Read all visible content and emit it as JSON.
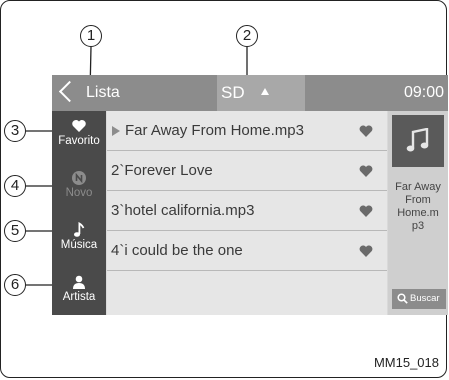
{
  "header": {
    "back_label": "Lista",
    "source_label": "SD",
    "clock": "09:00"
  },
  "sidebar": {
    "items": [
      {
        "label": "Favorito",
        "icon": "heart-icon"
      },
      {
        "label": "Novo",
        "icon": "new-badge-icon"
      },
      {
        "label": "Música",
        "icon": "music-note-icon"
      },
      {
        "label": "Artista",
        "icon": "person-icon"
      }
    ]
  },
  "tracks": [
    {
      "title": "Far Away From Home.mp3"
    },
    {
      "title": "2`Forever Love"
    },
    {
      "title": "3`hotel california.mp3"
    },
    {
      "title": "4`i could be the one"
    }
  ],
  "now_playing": {
    "name_lines": [
      "Far Away",
      "From",
      "Home.m",
      "p3"
    ],
    "search_label": "Buscar"
  },
  "callouts": [
    "1",
    "2",
    "3",
    "4",
    "5",
    "6"
  ],
  "caption": "MM15_018",
  "colors": {
    "header": "#8c8c8c",
    "sidebar": "#4a4a4a",
    "list": "#e6e6e6"
  }
}
